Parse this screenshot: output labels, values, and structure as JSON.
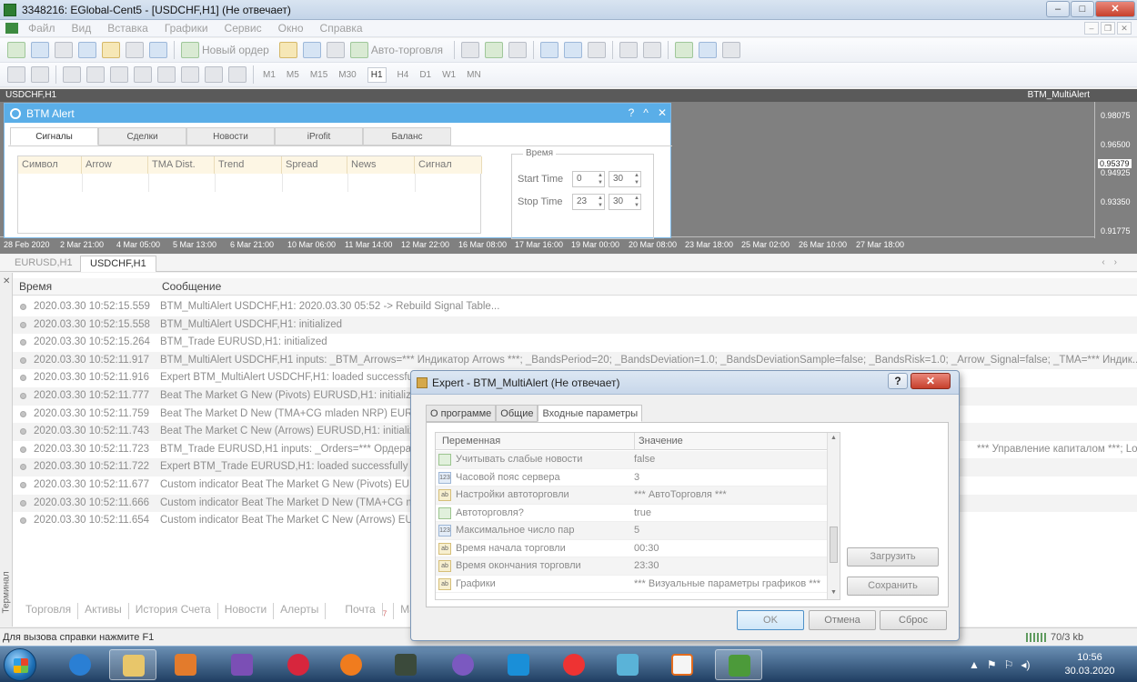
{
  "window": {
    "title": "3348216: EGlobal-Cent5 - [USDCHF,H1] (Не отвечает)"
  },
  "menu": [
    "Файл",
    "Вид",
    "Вставка",
    "Графики",
    "Сервис",
    "Окно",
    "Справка"
  ],
  "toolbar": {
    "new_order": "Новый ордер",
    "autotrading": "Авто-торговля"
  },
  "timeframes": [
    "M1",
    "M5",
    "M15",
    "M30",
    "H1",
    "H4",
    "D1",
    "W1",
    "MN"
  ],
  "chart": {
    "symbol": "USDCHF,H1",
    "indicator": "BTM_MultiAlert",
    "prices": [
      "0.98075",
      "0.96500",
      "0.95379",
      "0.94925",
      "0.93350",
      "0.91775"
    ],
    "current_price": "0.95379",
    "time_labels": [
      "28 Feb 2020",
      "2 Mar 21:00",
      "4 Mar 05:00",
      "5 Mar 13:00",
      "6 Mar 21:00",
      "10 Mar 06:00",
      "11 Mar 14:00",
      "12 Mar 22:00",
      "16 Mar 08:00",
      "17 Mar 16:00",
      "19 Mar 00:00",
      "20 Mar 08:00",
      "23 Mar 18:00",
      "25 Mar 02:00",
      "26 Mar 10:00",
      "27 Mar 18:00"
    ]
  },
  "btm_alert": {
    "title": "BTM Alert",
    "controls": [
      "?",
      "^",
      "✕"
    ],
    "tabs": [
      "Сигналы",
      "Сделки",
      "Новости",
      "iProfit",
      "Баланс"
    ],
    "columns": [
      "Символ",
      "Arrow",
      "TMA Dist.",
      "Trend",
      "Spread",
      "News",
      "Сигнал"
    ],
    "time_group": "Время",
    "start_label": "Start Time",
    "start_hour": "0",
    "start_min": "30",
    "stop_label": "Stop Time",
    "stop_hour": "23",
    "stop_min": "30"
  },
  "chart_tabs": [
    "EURUSD,H1",
    "USDCHF,H1"
  ],
  "log": {
    "col_time": "Время",
    "col_message": "Сообщение",
    "rows": [
      {
        "time": "2020.03.30 10:52:15.559",
        "msg": "BTM_MultiAlert USDCHF,H1: 2020.03.30 05:52 -> Rebuild Signal Table..."
      },
      {
        "time": "2020.03.30 10:52:15.558",
        "msg": "BTM_MultiAlert USDCHF,H1: initialized"
      },
      {
        "time": "2020.03.30 10:52:15.264",
        "msg": "BTM_Trade EURUSD,H1: initialized"
      },
      {
        "time": "2020.03.30 10:52:11.917",
        "msg": "BTM_MultiAlert USDCHF,H1 inputs: _BTM_Arrows=*** Индикатор Arrows ***; _BandsPeriod=20; _BandsDeviation=1.0; _BandsDeviationSample=false; _BandsRisk=1.0; _Arrow_Signal=false; _TMA=*** Индик..."
      },
      {
        "time": "2020.03.30 10:52:11.916",
        "msg": "Expert BTM_MultiAlert USDCHF,H1: loaded successfully"
      },
      {
        "time": "2020.03.30 10:52:11.777",
        "msg": "Beat The Market G New (Pivots) EURUSD,H1: initialized"
      },
      {
        "time": "2020.03.30 10:52:11.759",
        "msg": "Beat The Market D New (TMA+CG mladen NRP) EURUSD,H1: initialized"
      },
      {
        "time": "2020.03.30 10:52:11.743",
        "msg": "Beat The Market C New (Arrows) EURUSD,H1: initialized"
      },
      {
        "time": "2020.03.30 10:52:11.723",
        "msg": "BTM_Trade EURUSD,H1 inputs: _Orders=*** Ордера ***"
      },
      {
        "time": "2020.03.30 10:52:11.722",
        "msg": "Expert BTM_Trade EURUSD,H1: loaded successfully"
      },
      {
        "time": "2020.03.30 10:52:11.677",
        "msg": "Custom indicator Beat The Market G New (Pivots) EURUSD,H1: loaded successfully"
      },
      {
        "time": "2020.03.30 10:52:11.666",
        "msg": "Custom indicator Beat The Market D New (TMA+CG mladen NRP) EURUSD,H1: loaded successfully"
      },
      {
        "time": "2020.03.30 10:52:11.654",
        "msg": "Custom indicator Beat The Market C New (Arrows) EURUSD,H1: loaded successfully"
      }
    ],
    "row9_tail": "*** Управление капиталом ***; Lot..."
  },
  "terminal": {
    "side_label": "Терминал",
    "tabs": [
      "Торговля",
      "Активы",
      "История Счета",
      "Новости",
      "Алерты",
      "Почта",
      "Маркет"
    ],
    "mail_count": "7"
  },
  "status": {
    "help": "Для вызова справки нажмите F1",
    "traffic": "70/3 kb"
  },
  "expert": {
    "title": "Expert - BTM_MultiAlert (Не отвечает)",
    "help_btn": "?",
    "tabs": [
      "О программе",
      "Общие",
      "Входные параметры"
    ],
    "col_var": "Переменная",
    "col_val": "Значение",
    "params": [
      {
        "type": "bool",
        "name": "Учитывать слабые новости",
        "value": "false"
      },
      {
        "type": "num",
        "name": "Часовой пояс сервера",
        "value": "3"
      },
      {
        "type": "str",
        "name": "Настройки автоторговли",
        "value": "*** АвтоТорговля ***"
      },
      {
        "type": "bool",
        "name": "Автоторговля?",
        "value": "true"
      },
      {
        "type": "num",
        "name": "Максимальное число пар",
        "value": "5"
      },
      {
        "type": "str",
        "name": "Время начала торговли",
        "value": "00:30"
      },
      {
        "type": "str",
        "name": "Время окончания торговли",
        "value": "23:30"
      },
      {
        "type": "str",
        "name": "Графики",
        "value": "*** Визуальные параметры графиков ***"
      }
    ],
    "load_btn": "Загрузить",
    "save_btn": "Сохранить",
    "ok_btn": "OK",
    "cancel_btn": "Отмена",
    "reset_btn": "Сброс"
  },
  "taskbar": {
    "time": "10:56",
    "date": "30.03.2020"
  }
}
